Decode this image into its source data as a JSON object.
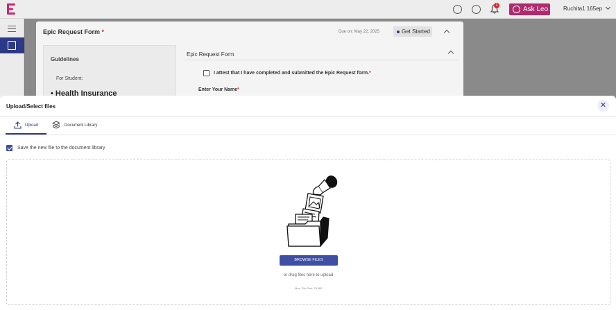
{
  "colors": {
    "brand": "#2d3987",
    "accent": "#3f4fa3",
    "ask_leo": "#b02a6e",
    "required": "#d8282f"
  },
  "header": {
    "icons": [
      "brand-logo-icon",
      "help-icon",
      "support-headset-icon",
      "bell-icon"
    ],
    "notification_count": "3",
    "ask_leo_label": "Ask Leo",
    "user_name": "Ruchita1 165ep"
  },
  "sidebar": {
    "icons": [
      "hamburger-icon",
      "form-edit-icon"
    ]
  },
  "background_form": {
    "title": "Epic Request Form",
    "required_mark": "*",
    "due_text": "Due on: May 22, 2025",
    "get_started_label": "Get Started",
    "guidelines_title": "Guidelines",
    "guidelines_for": "For Student:",
    "guidelines_item": "• Health Insurance",
    "form_section_title": "Epic Request Form",
    "attest_label": "I attest that I have completed and submitted the Epic Request form.",
    "name_label": "Enter Your Name"
  },
  "modal": {
    "title": "Upload/Select files",
    "close_icon": "close-icon",
    "tabs": [
      {
        "label": "Upload",
        "icon": "upload-icon",
        "active": true
      },
      {
        "label": "Document Library",
        "icon": "layers-icon",
        "active": false
      }
    ],
    "save_to_library": {
      "label": "Save the new file to the document library",
      "checked": true
    },
    "dropzone": {
      "browse_label": "BROWSE FILES",
      "drag_text": "or drag files here to upload",
      "max_size_text": "Max. File Size: 25 MB"
    }
  }
}
